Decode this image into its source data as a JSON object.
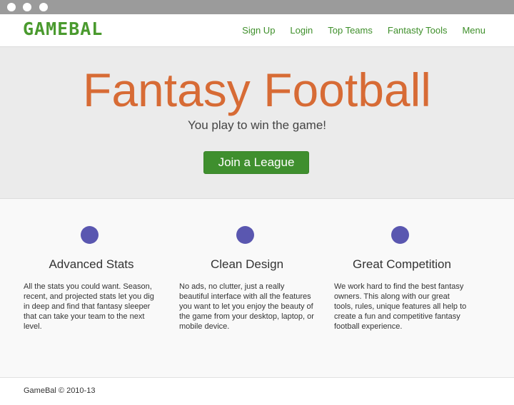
{
  "brand": {
    "logo": "GAMEBAL"
  },
  "nav": {
    "items": [
      {
        "label": "Sign Up"
      },
      {
        "label": "Login"
      },
      {
        "label": "Top Teams"
      },
      {
        "label": "Fantasty Tools"
      },
      {
        "label": "Menu"
      }
    ]
  },
  "hero": {
    "title": "Fantasy Football",
    "subtitle": "You play to win the game!",
    "cta_label": "Join a League"
  },
  "features": [
    {
      "title": "Advanced Stats",
      "text": "All the stats you could want. Season, recent, and projected stats let you dig in deep and find that fantasy sleeper that can take your team to the next level."
    },
    {
      "title": "Clean Design",
      "text": "No ads, no clutter, just a really beautiful interface with all the features you want to let you enjoy the beauty of the game from your desktop, laptop, or mobile device."
    },
    {
      "title": "Great Competition",
      "text": "We work hard to find the best fantasy owners. This along with our great tools, rules, unique features all help to create a fun and competitive fantasy football experience."
    }
  ],
  "footer": {
    "copyright": "GameBal © 2010-13"
  },
  "colors": {
    "brand_green": "#3f8f2e",
    "hero_orange": "#d76b35",
    "feature_circle": "#5a57b0"
  }
}
